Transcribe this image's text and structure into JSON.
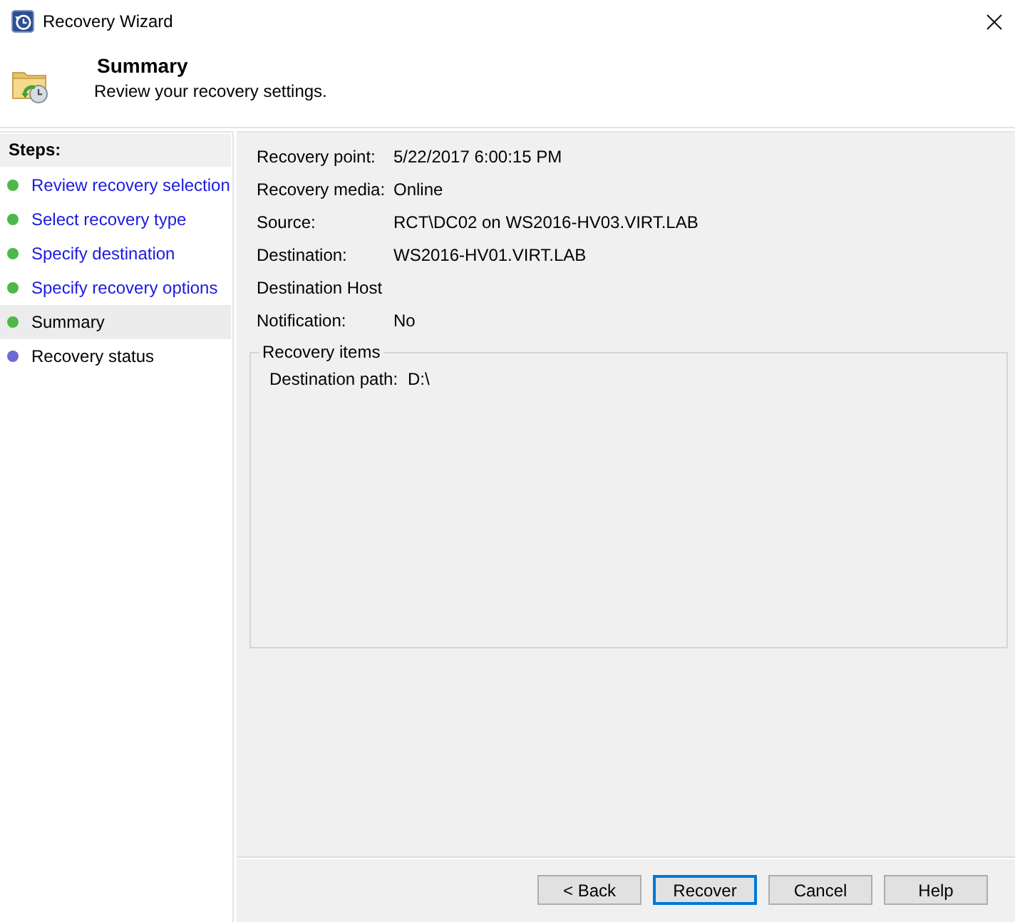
{
  "window": {
    "title": "Recovery Wizard"
  },
  "header": {
    "title": "Summary",
    "subtitle": "Review your recovery settings."
  },
  "steps": {
    "heading": "Steps:",
    "items": [
      {
        "label": "Review recovery selection",
        "kind": "link",
        "color": "#4cb848",
        "selected": false
      },
      {
        "label": "Select recovery type",
        "kind": "link",
        "color": "#4cb848",
        "selected": false
      },
      {
        "label": "Specify destination",
        "kind": "link",
        "color": "#4cb848",
        "selected": false
      },
      {
        "label": "Specify recovery options",
        "kind": "link",
        "color": "#4cb848",
        "selected": false
      },
      {
        "label": "Summary",
        "kind": "plain",
        "color": "#4cb848",
        "selected": true
      },
      {
        "label": "Recovery status",
        "kind": "plain",
        "color": "#6a6ad0",
        "selected": false
      }
    ]
  },
  "details": [
    {
      "label": "Recovery point:",
      "value": "5/22/2017 6:00:15 PM"
    },
    {
      "label": "Recovery media:",
      "value": "Online"
    },
    {
      "label": "Source:",
      "value": "RCT\\DC02 on WS2016-HV03.VIRT.LAB"
    },
    {
      "label": "Destination:",
      "value": "WS2016-HV01.VIRT.LAB"
    },
    {
      "label": "Destination Host"
    },
    {
      "label": "Notification:",
      "value": "No"
    }
  ],
  "recovery_items": {
    "title": "Recovery items",
    "rows": [
      {
        "label": "Destination path:",
        "value": "D:\\"
      }
    ]
  },
  "buttons": [
    {
      "label": "< Back",
      "focused": false
    },
    {
      "label": "Recover",
      "focused": true
    },
    {
      "label": "Cancel",
      "focused": false
    },
    {
      "label": "Help",
      "focused": false
    }
  ]
}
